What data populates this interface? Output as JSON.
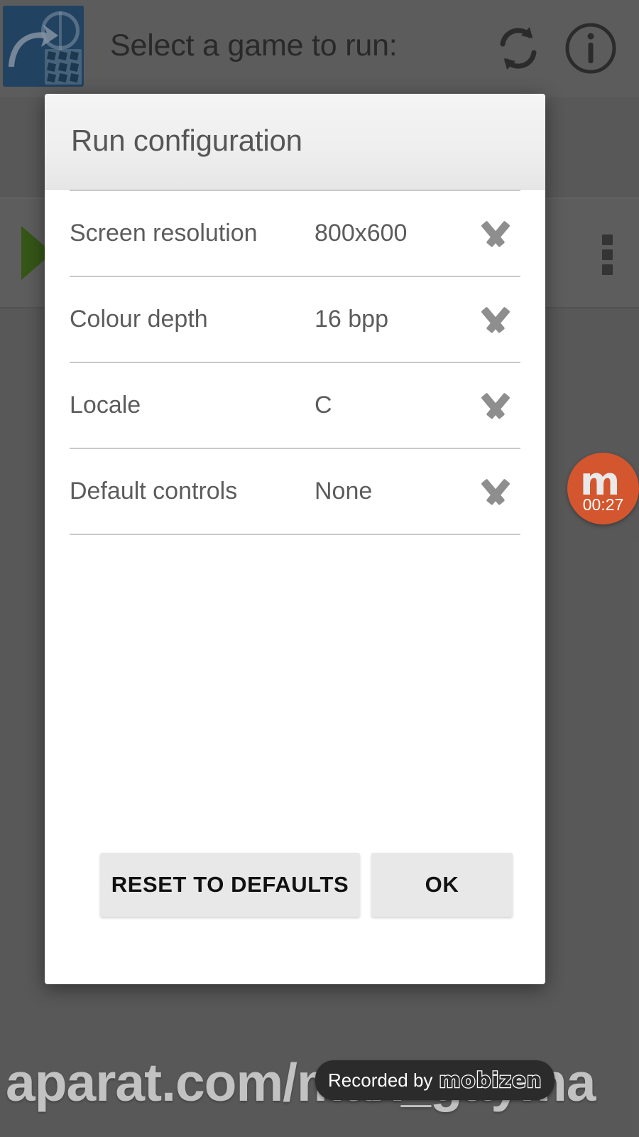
{
  "app_bar": {
    "title": "Select a game to run:",
    "icon_name": "scummvm-app-icon",
    "refresh_icon": "refresh-icon",
    "info_icon": "info-icon"
  },
  "game_list": {
    "play_icon": "play-triangle-icon",
    "overflow_icon": "overflow-menu-icon"
  },
  "dialog": {
    "title": "Run configuration",
    "settings": [
      {
        "label": "Screen resolution",
        "value": "800x600",
        "chevron": "chevron-down-icon"
      },
      {
        "label": "Colour depth",
        "value": "16 bpp",
        "chevron": "chevron-down-icon"
      },
      {
        "label": "Locale",
        "value": "C",
        "chevron": "chevron-down-icon"
      },
      {
        "label": "Default controls",
        "value": "None",
        "chevron": "chevron-down-icon"
      }
    ],
    "buttons": {
      "reset": "RESET TO DEFAULTS",
      "ok": "OK"
    }
  },
  "mobizen_widget": {
    "logo": "m",
    "timer": "00:27",
    "color": "#d4562f"
  },
  "watermarks": {
    "aparat": "aparat.com/max_gayma",
    "recorded_by": "Recorded by",
    "mobizen_wordmark": "mobizen"
  },
  "colors": {
    "backdrop": "#6e6e6e",
    "dialog_bg": "#ffffff",
    "dialog_header": "#efefef",
    "text_muted": "#5c5c5c",
    "divider": "#c9c9c9",
    "app_icon_blue": "#1f4e79",
    "play_green": "#3b6b11",
    "button_bg": "#e8e8e8"
  }
}
